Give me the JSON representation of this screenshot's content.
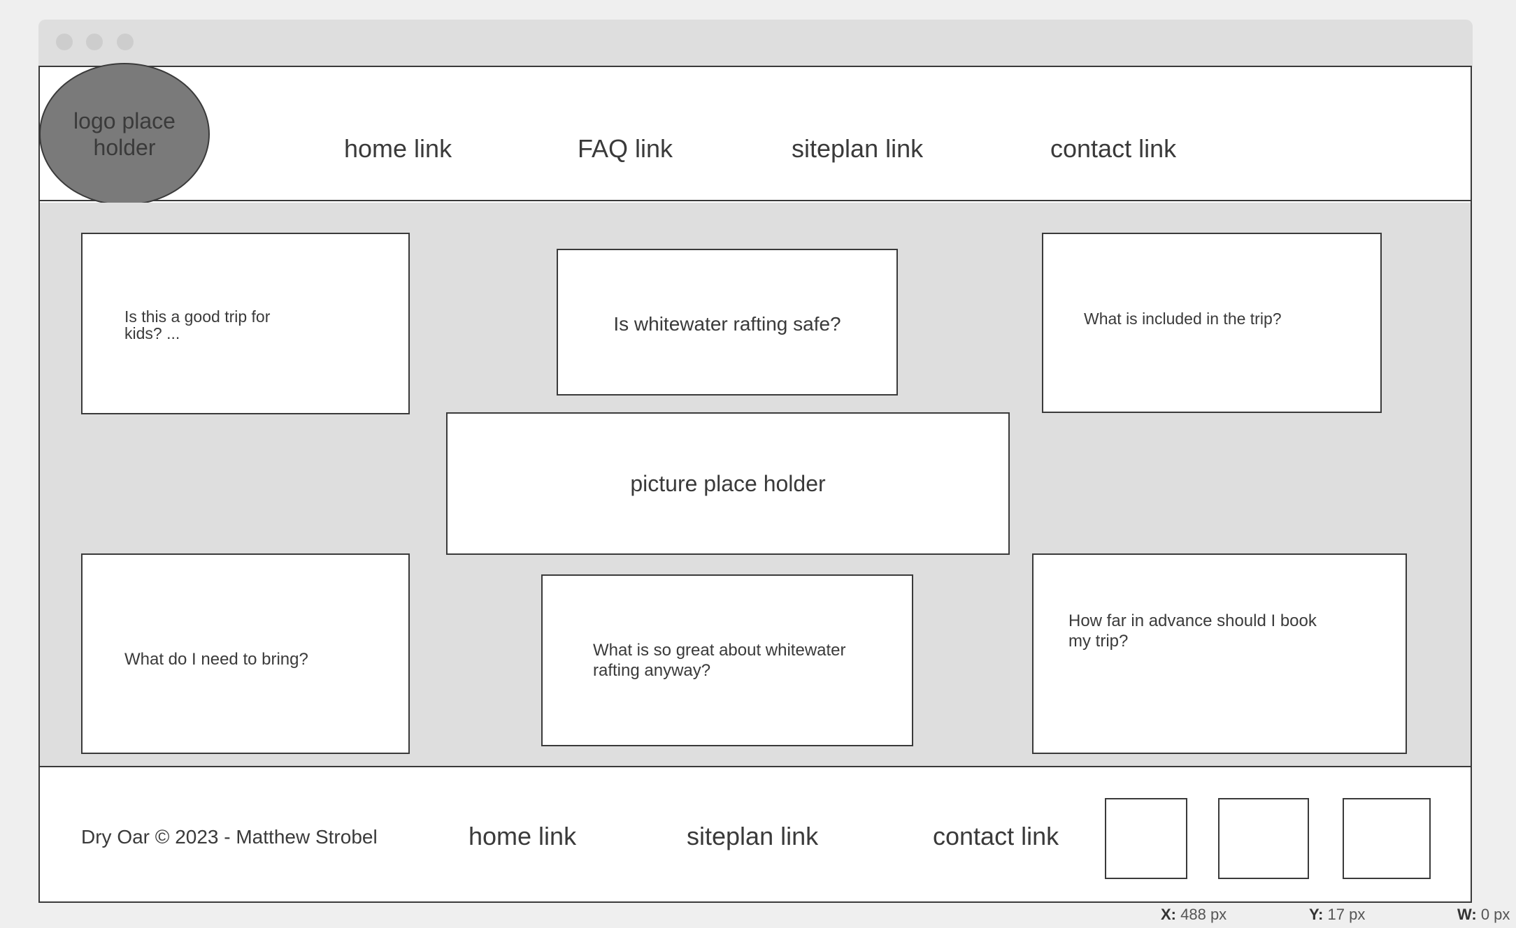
{
  "header": {
    "logo": "logo place holder",
    "nav": [
      "home link",
      "FAQ link",
      "siteplan link",
      "contact link"
    ]
  },
  "faq": {
    "kids": "Is this a good trip for kids? ...",
    "safe": "Is whitewater rafting safe?",
    "included": "What is included in the trip?",
    "picture": "picture place holder",
    "bring": "What do I need to bring?",
    "great": "What is so great about whitewater rafting anyway?",
    "advance": "How far in advance should I book my trip?"
  },
  "footer": {
    "copyright": "Dry Oar © 2023 - Matthew Strobel",
    "links": [
      "home link",
      "siteplan link",
      "contact link"
    ]
  },
  "status": {
    "x_label": "X:",
    "x_value": "488 px",
    "y_label": "Y:",
    "y_value": "17 px",
    "w_label": "W:",
    "w_value": "0 px"
  }
}
